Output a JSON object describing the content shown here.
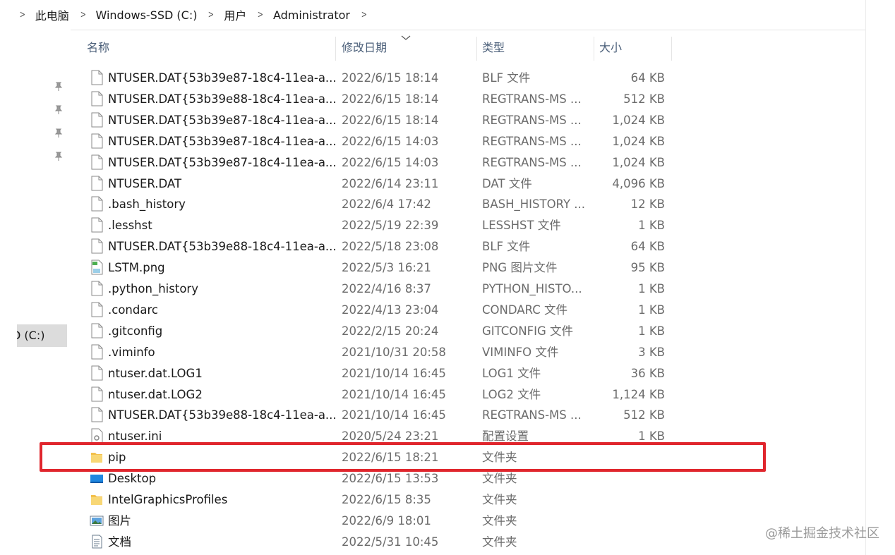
{
  "breadcrumb": [
    "此电脑",
    "Windows-SSD (C:)",
    "用户",
    "Administrator"
  ],
  "nav": {
    "pinned_icon": "pin-icon",
    "drive_label": "D (C:)"
  },
  "columns": {
    "name": "名称",
    "date": "修改日期",
    "type": "类型",
    "size": "大小"
  },
  "files": [
    {
      "name": "NTUSER.DAT{53b39e87-18c4-11ea-a...",
      "date": "2022/6/15 18:14",
      "type": "BLF 文件",
      "size": "64 KB",
      "icon": "file-icon"
    },
    {
      "name": "NTUSER.DAT{53b39e88-18c4-11ea-a...",
      "date": "2022/6/15 18:14",
      "type": "REGTRANS-MS ...",
      "size": "512 KB",
      "icon": "file-icon"
    },
    {
      "name": "NTUSER.DAT{53b39e87-18c4-11ea-a...",
      "date": "2022/6/15 18:14",
      "type": "REGTRANS-MS ...",
      "size": "1,024 KB",
      "icon": "file-icon"
    },
    {
      "name": "NTUSER.DAT{53b39e87-18c4-11ea-a...",
      "date": "2022/6/15 14:03",
      "type": "REGTRANS-MS ...",
      "size": "1,024 KB",
      "icon": "file-icon"
    },
    {
      "name": "NTUSER.DAT{53b39e87-18c4-11ea-a...",
      "date": "2022/6/15 14:03",
      "type": "REGTRANS-MS ...",
      "size": "1,024 KB",
      "icon": "file-icon"
    },
    {
      "name": "NTUSER.DAT",
      "date": "2022/6/14 23:11",
      "type": "DAT 文件",
      "size": "4,096 KB",
      "icon": "file-icon"
    },
    {
      "name": ".bash_history",
      "date": "2022/6/4 17:42",
      "type": "BASH_HISTORY ...",
      "size": "12 KB",
      "icon": "file-icon"
    },
    {
      "name": ".lesshst",
      "date": "2022/5/19 22:39",
      "type": "LESSHST 文件",
      "size": "1 KB",
      "icon": "file-icon"
    },
    {
      "name": "NTUSER.DAT{53b39e88-18c4-11ea-a...",
      "date": "2022/5/18 23:08",
      "type": "BLF 文件",
      "size": "64 KB",
      "icon": "file-icon"
    },
    {
      "name": "LSTM.png",
      "date": "2022/5/3 16:21",
      "type": "PNG 图片文件",
      "size": "95 KB",
      "icon": "image-file-icon"
    },
    {
      "name": ".python_history",
      "date": "2022/4/16 8:37",
      "type": "PYTHON_HISTO...",
      "size": "1 KB",
      "icon": "file-icon"
    },
    {
      "name": ".condarc",
      "date": "2022/4/13 23:04",
      "type": "CONDARC 文件",
      "size": "1 KB",
      "icon": "file-icon"
    },
    {
      "name": ".gitconfig",
      "date": "2022/2/15 20:24",
      "type": "GITCONFIG 文件",
      "size": "1 KB",
      "icon": "file-icon"
    },
    {
      "name": ".viminfo",
      "date": "2021/10/31 20:58",
      "type": "VIMINFO 文件",
      "size": "3 KB",
      "icon": "file-icon"
    },
    {
      "name": "ntuser.dat.LOG1",
      "date": "2021/10/14 16:45",
      "type": "LOG1 文件",
      "size": "36 KB",
      "icon": "file-icon"
    },
    {
      "name": "ntuser.dat.LOG2",
      "date": "2021/10/14 16:45",
      "type": "LOG2 文件",
      "size": "1,124 KB",
      "icon": "file-icon"
    },
    {
      "name": "NTUSER.DAT{53b39e88-18c4-11ea-a...",
      "date": "2021/10/14 16:45",
      "type": "REGTRANS-MS ...",
      "size": "512 KB",
      "icon": "file-icon"
    },
    {
      "name": "ntuser.ini",
      "date": "2020/5/24 23:21",
      "type": "配置设置",
      "size": "1 KB",
      "icon": "settings-file-icon"
    },
    {
      "name": "pip",
      "date": "2022/6/15 18:21",
      "type": "文件夹",
      "size": "",
      "icon": "folder-icon"
    },
    {
      "name": "Desktop",
      "date": "2022/6/15 13:53",
      "type": "文件夹",
      "size": "",
      "icon": "desktop-folder-icon"
    },
    {
      "name": "IntelGraphicsProfiles",
      "date": "2022/6/15 8:35",
      "type": "文件夹",
      "size": "",
      "icon": "folder-icon"
    },
    {
      "name": "图片",
      "date": "2022/6/9 18:01",
      "type": "文件夹",
      "size": "",
      "icon": "pictures-folder-icon"
    },
    {
      "name": "文档",
      "date": "2022/5/31 10:45",
      "type": "文件夹",
      "size": "",
      "icon": "documents-folder-icon"
    }
  ],
  "highlighted_item": "pip",
  "colors": {
    "highlight": "#e0262d",
    "header_text": "#4c607a",
    "folder": "#f3c04c"
  },
  "watermark": "@稀土掘金技术社区"
}
